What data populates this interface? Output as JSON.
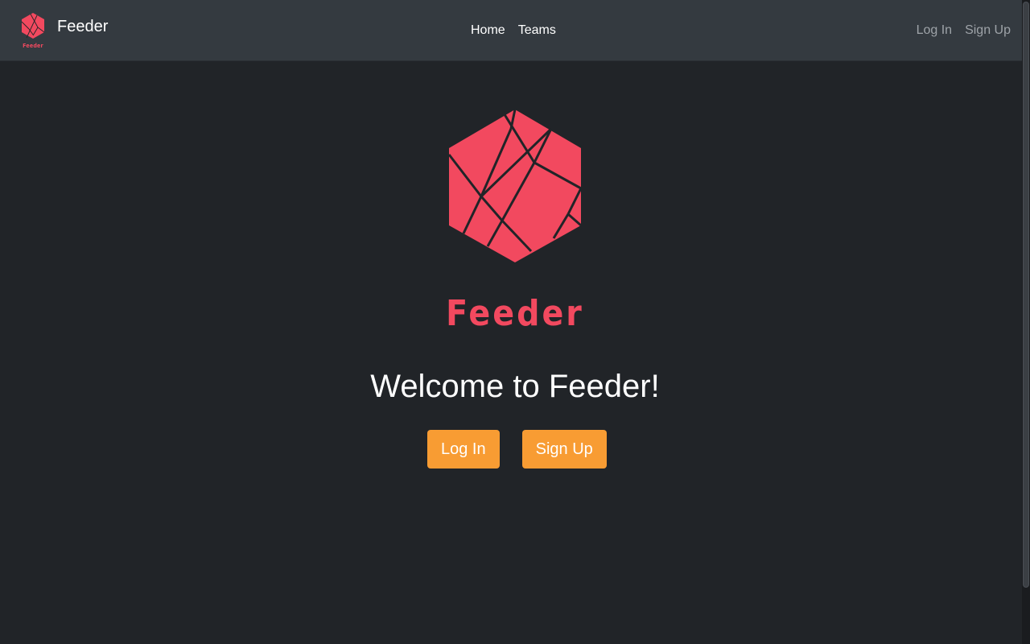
{
  "navbar": {
    "brand_name": "Feeder",
    "brand_logo_text": "Feeder",
    "links": [
      {
        "label": "Home"
      },
      {
        "label": "Teams"
      }
    ],
    "auth": {
      "login_label": "Log In",
      "signup_label": "Sign Up"
    }
  },
  "hero": {
    "wordmark": "Feeder",
    "welcome": "Welcome to Feeder!",
    "login_button": "Log In",
    "signup_button": "Sign Up"
  },
  "colors": {
    "brand": "#f2495f",
    "accent_button": "#f89c33",
    "background": "#212428",
    "navbar": "#343a40"
  }
}
